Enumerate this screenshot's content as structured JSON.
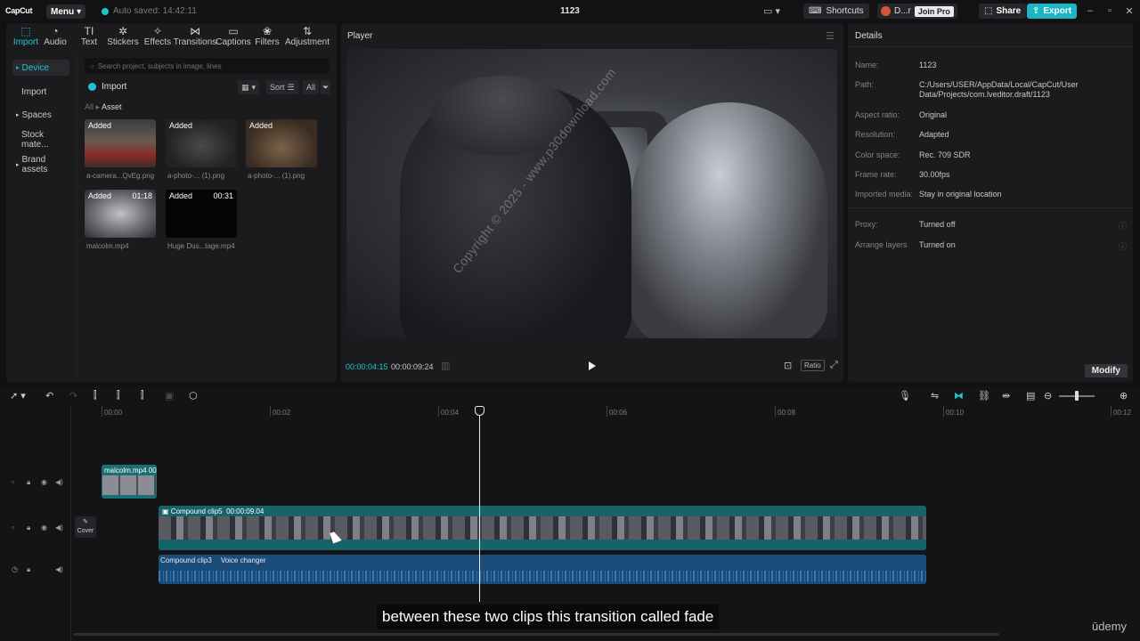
{
  "titlebar": {
    "logo": "CapCut",
    "menu_label": "Menu",
    "autosave": "Auto saved: 14:42:11",
    "project_title": "1123",
    "shortcuts_label": "Shortcuts",
    "user_label": "D...r",
    "join_pro_label": "Join Pro",
    "share_label": "Share",
    "export_label": "Export"
  },
  "tools": [
    {
      "label": "Import",
      "icon": "import-icon",
      "glyph": "⬚"
    },
    {
      "label": "Audio",
      "icon": "audio-icon",
      "glyph": "◔"
    },
    {
      "label": "Text",
      "icon": "text-icon",
      "glyph": "TI"
    },
    {
      "label": "Stickers",
      "icon": "stickers-icon",
      "glyph": "✲"
    },
    {
      "label": "Effects",
      "icon": "effects-icon",
      "glyph": "✧"
    },
    {
      "label": "Transitions",
      "icon": "transitions-icon",
      "glyph": "⋈"
    },
    {
      "label": "Captions",
      "icon": "captions-icon",
      "glyph": "▭"
    },
    {
      "label": "Filters",
      "icon": "filters-icon",
      "glyph": "❀"
    },
    {
      "label": "Adjustment",
      "icon": "adjustment-icon",
      "glyph": "⇅"
    }
  ],
  "side_nav": [
    {
      "label": "Device"
    },
    {
      "label": "Import"
    },
    {
      "label": "Spaces"
    },
    {
      "label": "Stock mate..."
    },
    {
      "label": "Brand assets"
    }
  ],
  "media": {
    "search_placeholder": "Search project, subjects in image, lines",
    "import_label": "Import",
    "sort_label": "Sort",
    "filter_label": "All",
    "breadcrumb_root": "All",
    "breadcrumb_current": "Asset",
    "items": [
      {
        "status": "Added",
        "name": "a-camera...QvEg.png",
        "duration": ""
      },
      {
        "status": "Added",
        "name": "a-photo-... (1).png",
        "duration": ""
      },
      {
        "status": "Added",
        "name": "a-photo-... (1).png",
        "duration": ""
      },
      {
        "status": "Added",
        "name": "malcolm.mp4",
        "duration": "01:18"
      },
      {
        "status": "Added",
        "name": "Huge Dus...tage.mp4",
        "duration": "00:31"
      }
    ]
  },
  "player": {
    "title": "Player",
    "current_time": "00:00:04:15",
    "total_time": "00:00:09:24",
    "ratio_label": "Ratio"
  },
  "details": {
    "title": "Details",
    "rows": [
      {
        "key": "Name:",
        "value": "1123"
      },
      {
        "key": "Path:",
        "value": "C:/Users/USER/AppData/Local/CapCut/User Data/Projects/com.lveditor.draft/1123"
      },
      {
        "key": "Aspect ratio:",
        "value": "Original"
      },
      {
        "key": "Resolution:",
        "value": "Adapted"
      },
      {
        "key": "Color space:",
        "value": "Rec. 709 SDR"
      },
      {
        "key": "Frame rate:",
        "value": "30.00fps"
      },
      {
        "key": "Imported media:",
        "value": "Stay in original location"
      },
      {
        "key": "Proxy:",
        "value": "Turned off"
      },
      {
        "key": "Arrange layers",
        "value": "Turned on"
      }
    ],
    "modify_label": "Modify"
  },
  "timeline": {
    "ruler": [
      "00:00",
      "00:02",
      "00:04",
      "00:06",
      "00:08",
      "00:10",
      "00:12"
    ],
    "cover_label": "Cover",
    "clips": {
      "overlay_name": "malcolm.mp4",
      "overlay_extra": "00",
      "main_name": "Compound clip5",
      "main_duration": "00:00:09.04",
      "audio_name": "Compound clip3",
      "audio_effect": "Voice changer"
    }
  },
  "overlay": {
    "subtitle": "between these two clips this transition called fade",
    "brand": "ūdemy",
    "watermark": "Copyright © 2025 - www.p30download.com"
  },
  "colors": {
    "accent": "#20c4d4",
    "export": "#1bb5c4",
    "main_clip": "#16646a",
    "audio_clip": "#1a4c7a"
  }
}
